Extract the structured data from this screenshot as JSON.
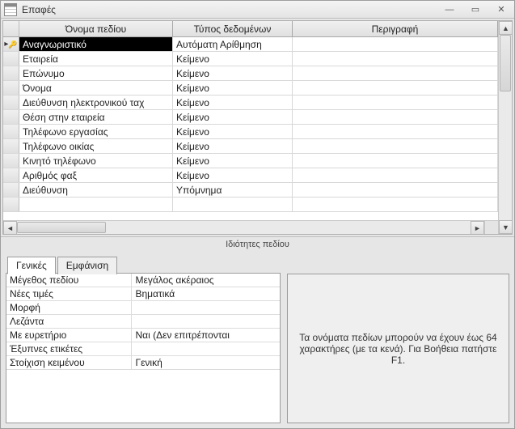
{
  "window": {
    "title": "Επαφές"
  },
  "grid": {
    "headers": {
      "field_name": "Όνομα πεδίου",
      "data_type": "Τύπος δεδομένων",
      "description": "Περιγραφή"
    },
    "rows": [
      {
        "name": "Αναγνωριστικό",
        "type": "Αυτόματη Αρίθμηση",
        "desc": "",
        "pk": true,
        "selected": true
      },
      {
        "name": "Εταιρεία",
        "type": "Κείμενο",
        "desc": ""
      },
      {
        "name": "Επώνυμο",
        "type": "Κείμενο",
        "desc": ""
      },
      {
        "name": "Όνομα",
        "type": "Κείμενο",
        "desc": ""
      },
      {
        "name": "Διεύθυνση ηλεκτρονικού ταχ",
        "type": "Κείμενο",
        "desc": ""
      },
      {
        "name": "Θέση στην εταιρεία",
        "type": "Κείμενο",
        "desc": ""
      },
      {
        "name": "Τηλέφωνο εργασίας",
        "type": "Κείμενο",
        "desc": ""
      },
      {
        "name": "Τηλέφωνο οικίας",
        "type": "Κείμενο",
        "desc": ""
      },
      {
        "name": "Κινητό τηλέφωνο",
        "type": "Κείμενο",
        "desc": ""
      },
      {
        "name": "Αριθμός φαξ",
        "type": "Κείμενο",
        "desc": ""
      },
      {
        "name": "Διεύθυνση",
        "type": "Υπόμνημα",
        "desc": ""
      }
    ]
  },
  "section_label": "Ιδιότητες πεδίου",
  "tabs": {
    "general": "Γενικές",
    "display": "Εμφάνιση"
  },
  "properties": [
    {
      "label": "Μέγεθος πεδίου",
      "value": "Μεγάλος ακέραιος"
    },
    {
      "label": "Νέες τιμές",
      "value": "Βηματικά"
    },
    {
      "label": "Μορφή",
      "value": ""
    },
    {
      "label": "Λεζάντα",
      "value": ""
    },
    {
      "label": "Με ευρετήριο",
      "value": "Ναι (Δεν επιτρέπονται"
    },
    {
      "label": "Έξυπνες ετικέτες",
      "value": ""
    },
    {
      "label": "Στοίχιση κειμένου",
      "value": "Γενική"
    }
  ],
  "hint": "Τα ονόματα πεδίων μπορούν να έχουν έως 64 χαρακτήρες (με τα κενά). Για Βοήθεια πατήστε F1."
}
